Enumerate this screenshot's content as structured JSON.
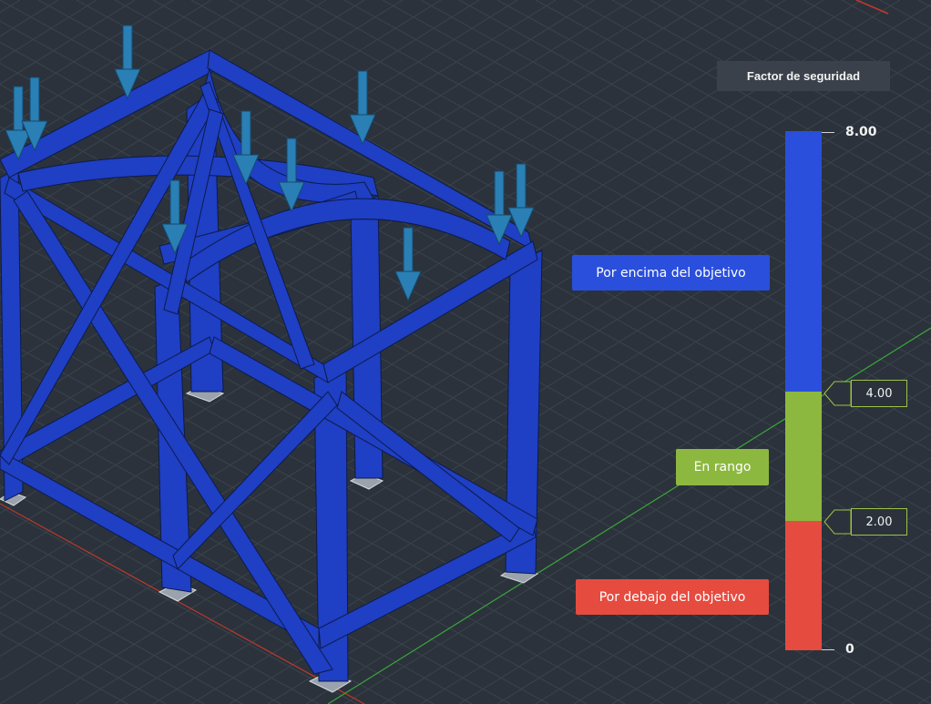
{
  "legend": {
    "title": "Factor de seguridad",
    "max_label": "8.00",
    "min_label": "0",
    "upper_threshold": "4.00",
    "lower_threshold": "2.00",
    "above_target_label": "Por encima del objetivo",
    "in_range_label": "En rango",
    "below_target_label": "Por debajo del objetivo"
  },
  "colors": {
    "background": "#2b323b",
    "above": "#2a4fdc",
    "in_range": "#8db83f",
    "below": "#e64b3f",
    "structure": "#1f3fc4",
    "load_arrow": "#2a7fb4"
  }
}
